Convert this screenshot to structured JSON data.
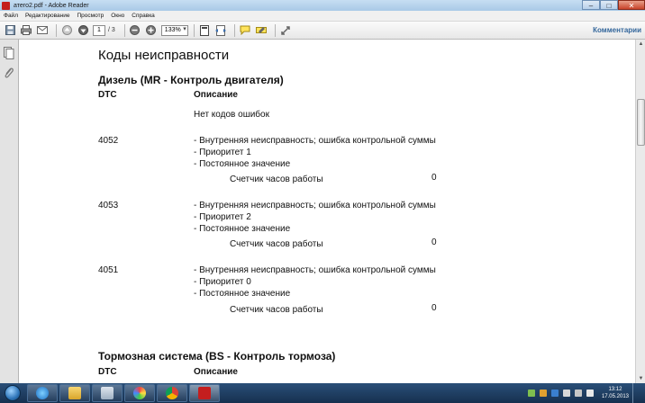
{
  "window": {
    "title": "атего2.pdf - Adobe Reader"
  },
  "menu": {
    "items": [
      "Файл",
      "Редактирование",
      "Просмотр",
      "Окно",
      "Справка"
    ]
  },
  "toolbar": {
    "page_current": "1",
    "page_total": "/ 3",
    "zoom": "133%",
    "comments_label": "Комментарии"
  },
  "document": {
    "title": "Коды неисправности",
    "section1": {
      "heading": "Дизель (MR - Контроль двигателя)",
      "col_dtc": "DTC",
      "col_desc": "Описание",
      "no_codes": "Нет кодов ошибок",
      "entries": [
        {
          "code": "4052",
          "lines": [
            "- Внутренняя неисправность; ошибка контрольной суммы",
            "- Приоритет 1",
            "- Постоянное значение"
          ],
          "counter_label": "Счетчик часов работы",
          "counter_value": "0"
        },
        {
          "code": "4053",
          "lines": [
            "- Внутренняя неисправность; ошибка контрольной суммы",
            "- Приоритет 2",
            "- Постоянное значение"
          ],
          "counter_label": "Счетчик часов работы",
          "counter_value": "0"
        },
        {
          "code": "4051",
          "lines": [
            "- Внутренняя неисправность; ошибка контрольной суммы",
            "- Приоритет 0",
            "- Постоянное значение"
          ],
          "counter_label": "Счетчик часов работы",
          "counter_value": "0"
        }
      ]
    },
    "section2": {
      "heading": "Тормозная система (BS - Контроль тормоза)",
      "col_dtc": "DTC",
      "col_desc": "Описание"
    }
  },
  "taskbar": {
    "time": "13:12",
    "date": "17.05.2013"
  },
  "colors": {
    "title_bar": "#b3d0ec",
    "comments_link": "#33669b",
    "taskbar": "#1d3a5e",
    "acrobat_red": "#c41e1e"
  },
  "icons": [
    "save-icon",
    "print-icon",
    "email-icon",
    "prev-page-icon",
    "next-page-icon",
    "zoom-out-icon",
    "zoom-in-icon",
    "fit-page-icon",
    "fit-width-icon",
    "comment-icon",
    "highlight-icon",
    "tools-icon"
  ]
}
